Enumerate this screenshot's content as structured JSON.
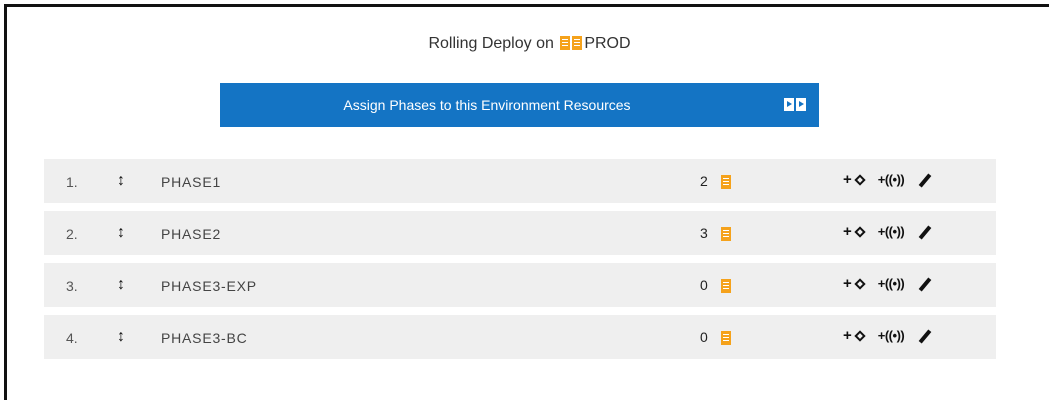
{
  "title": {
    "prefix": "Rolling Deploy on",
    "env": "PROD"
  },
  "assign_button": {
    "label": "Assign Phases to this Environment Resources"
  },
  "phases": [
    {
      "index": "1.",
      "name": "PHASE1",
      "count": "2"
    },
    {
      "index": "2.",
      "name": "PHASE2",
      "count": "3"
    },
    {
      "index": "3.",
      "name": "PHASE3-EXP",
      "count": "0"
    },
    {
      "index": "4.",
      "name": "PHASE3-BC",
      "count": "0"
    }
  ],
  "row_actions": {
    "add_node_plus": "+",
    "add_signal": "+((•))"
  },
  "colors": {
    "accent_blue": "#1474c4",
    "resource_orange": "#f5a21b",
    "row_bg": "#efefef"
  },
  "icons": {
    "env": "server-doc-icon",
    "assign": "double-arrow-right-icon",
    "drag": "drag-handle-icon",
    "resource": "resource-doc-icon",
    "add_node": "add-diamond-icon",
    "add_signal": "add-signal-icon",
    "edit": "pencil-icon"
  }
}
